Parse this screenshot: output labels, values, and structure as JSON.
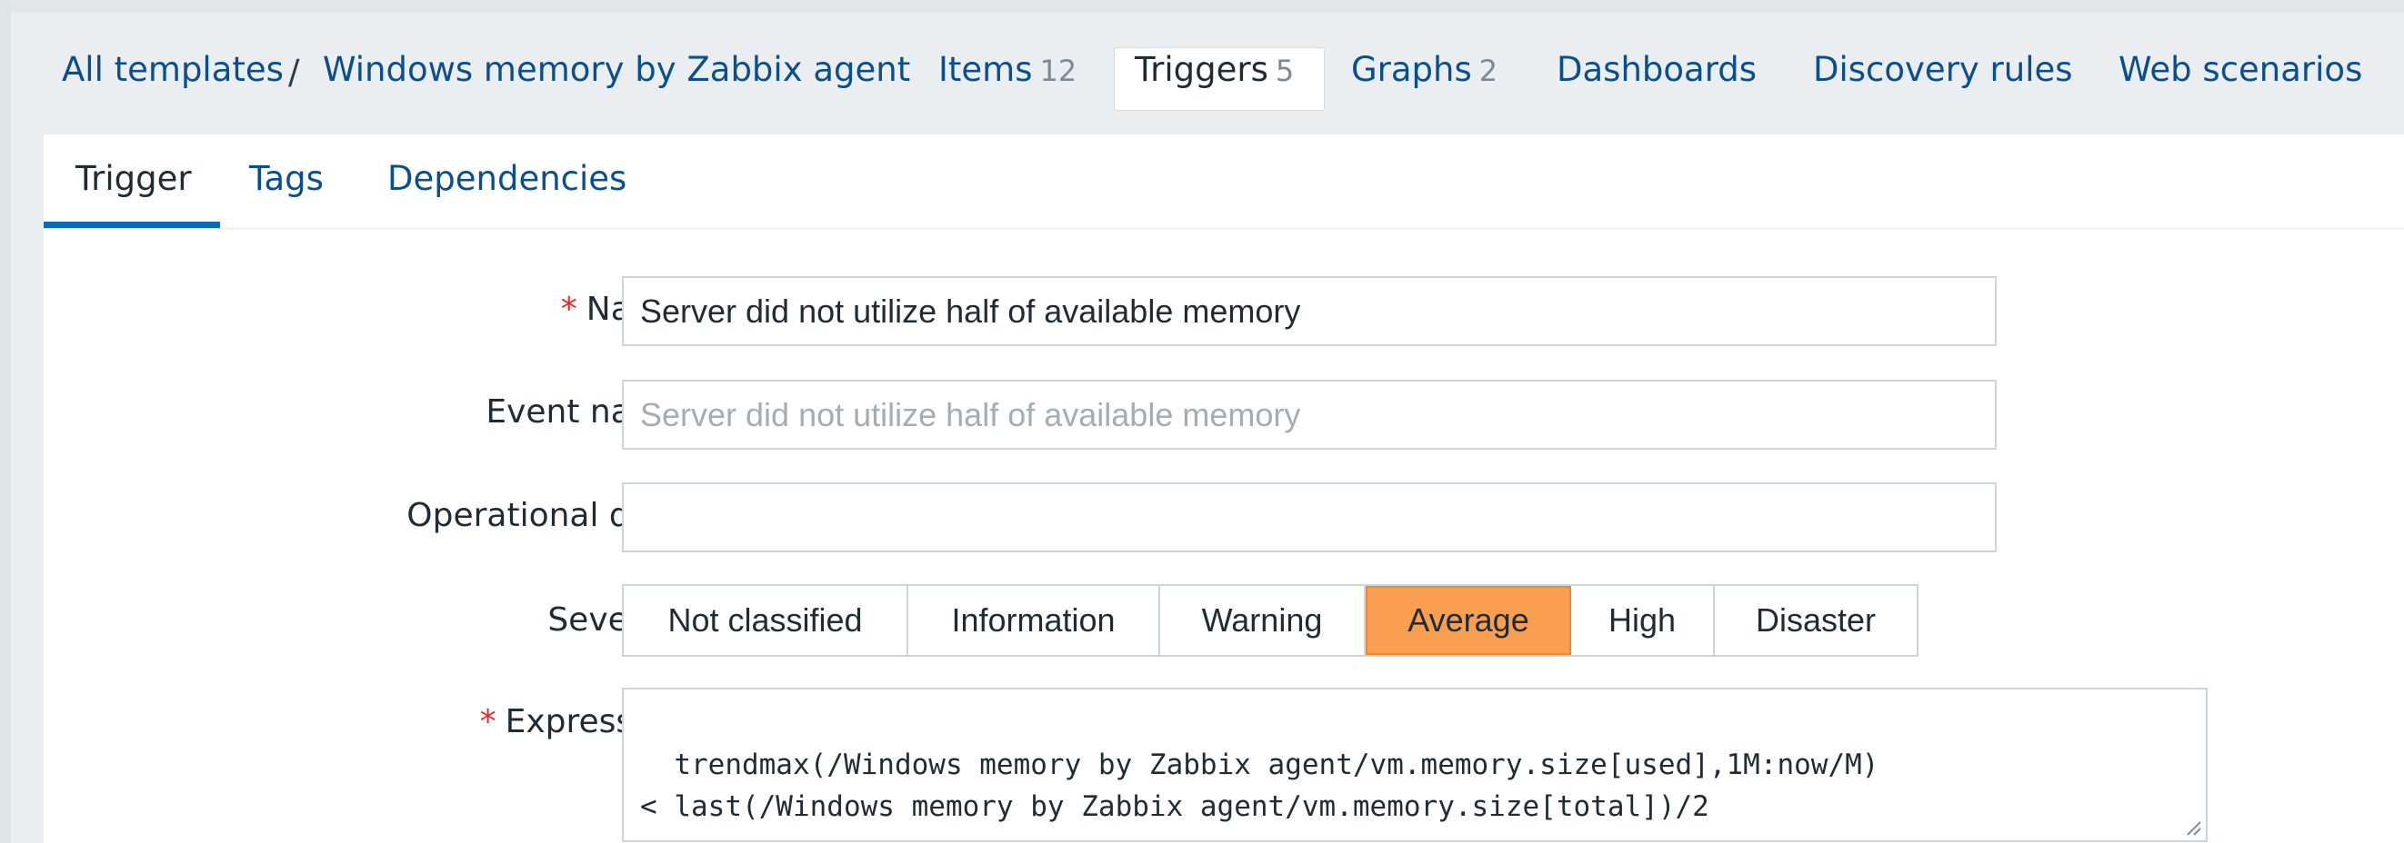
{
  "nav": {
    "breadcrumb_root": "All templates",
    "separator": "/",
    "template_name": "Windows memory by Zabbix agent",
    "items_label": "Items",
    "items_count": "12",
    "triggers_label": "Triggers",
    "triggers_count": "5",
    "graphs_label": "Graphs",
    "graphs_count": "2",
    "dashboards_label": "Dashboards",
    "discovery_label": "Discovery rules",
    "web_label": "Web scenarios"
  },
  "tabs": {
    "trigger": "Trigger",
    "tags": "Tags",
    "dependencies": "Dependencies"
  },
  "form": {
    "required_marker": "*",
    "name_label": "Name",
    "name_value": "Server did not utilize half of available memory",
    "event_name_label": "Event name",
    "event_name_placeholder": "Server did not utilize half of available memory",
    "opdata_label": "Operational data",
    "opdata_value": "",
    "severity_label": "Severity",
    "severity_options": [
      "Not classified",
      "Information",
      "Warning",
      "Average",
      "High",
      "Disaster"
    ],
    "severity_selected": "Average",
    "expression_label": "Expression",
    "expression_value": "trendmax(/Windows memory by Zabbix agent/vm.memory.size[used],1M:now/M)\n< last(/Windows memory by Zabbix agent/vm.memory.size[total])/2"
  },
  "colors": {
    "link": "#0a4e8e",
    "severity_average": "#f99f4f",
    "required": "#e02d2d",
    "tab_underline": "#0a6cb0"
  }
}
